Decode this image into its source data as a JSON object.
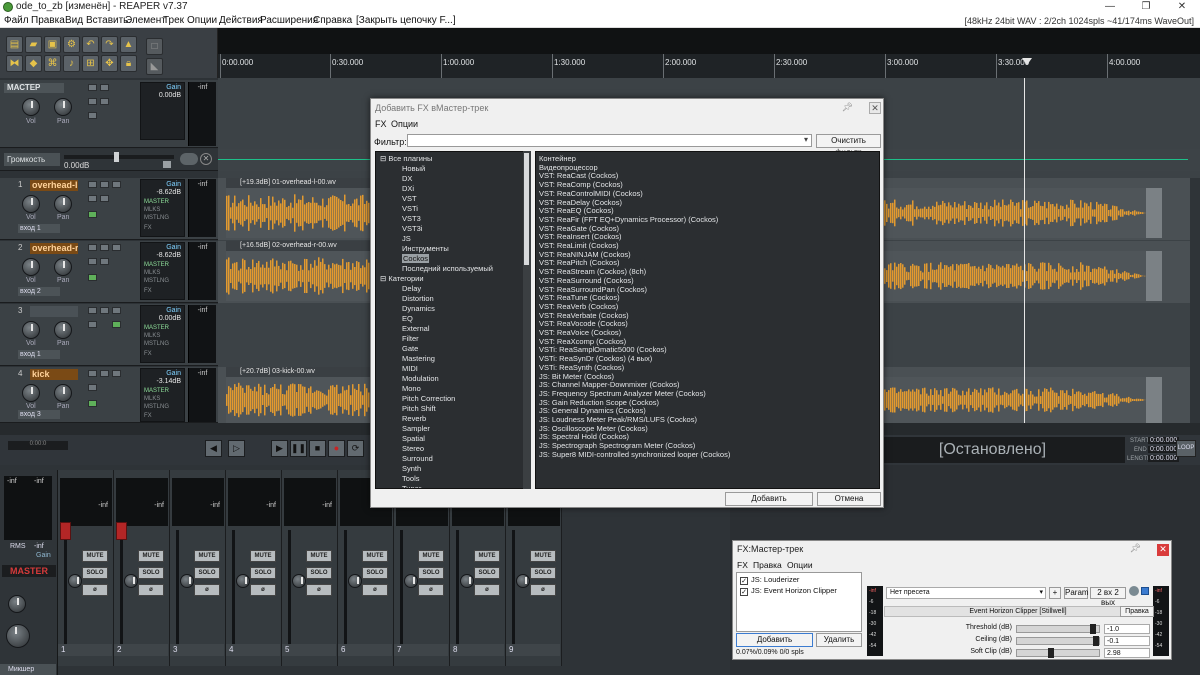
{
  "window": {
    "title": "ode_to_zb [изменён] - REAPER v7.37",
    "status_info": "[48kHz 24bit WAV : 2/2ch 1024spls ~41/174ms WaveOut]"
  },
  "menu": [
    "Файл",
    "Правка",
    "Вид",
    "Вставить",
    "Элемент",
    "Трек",
    "Опции",
    "Действия",
    "Расширения",
    "Справка",
    "[Закрыть цепочку F...]"
  ],
  "ruler": {
    "ticks": [
      "0:00.000",
      "0:30.000",
      "1:00.000",
      "1:30.000",
      "2:00.000",
      "2:30.000",
      "3:00.000",
      "3:30.000",
      "4:00.000"
    ]
  },
  "master": {
    "name": "МАСТЕР",
    "gain_label": "Gain",
    "gain_value": "0.00dB",
    "meter": "-inf",
    "vol_label": "Vol",
    "pan_label": "Pan",
    "volume_label": "Громкость",
    "volume_value": "0.00dB"
  },
  "tracks": [
    {
      "num": "1",
      "name": "overhead-l",
      "gain": "-8.62dB",
      "input": "вход 1",
      "meter": "-inf",
      "item": "[+19.3dB] 01-overhead-l-00.wv"
    },
    {
      "num": "2",
      "name": "overhead-r",
      "gain": "-8.62dB",
      "input": "вход 2",
      "meter": "-inf",
      "item": "[+16.5dB] 02-overhead-r-00.wv"
    },
    {
      "num": "3",
      "name": "",
      "gain": "0.00dB",
      "input": "вход 1",
      "meter": "-inf",
      "item": ""
    },
    {
      "num": "4",
      "name": "kick",
      "gain": "-3.14dB",
      "input": "вход 3",
      "meter": "-inf",
      "item": "[+20.7dB] 03-kick-00.wv"
    }
  ],
  "routing_labels": [
    "MASTER",
    "MLKS",
    "MSTLNG",
    "FX"
  ],
  "transport": {
    "status": "[Остановлено]",
    "start_label": "START",
    "end_label": "END",
    "length_label": "LENGTH",
    "start": "0:00.000",
    "end": "0:00.000",
    "length": "0:00.000",
    "loop_label": "LOOP",
    "counter": "0:00:0"
  },
  "mixer": {
    "master_label": "MASTER",
    "rms_label": "RMS",
    "rms_value": "-inf",
    "gain_label": "Gain",
    "tab_label": "Микшер",
    "strip_meter": "-inf",
    "mute": "MUTE",
    "solo": "SOLO",
    "strips": [
      "1",
      "2",
      "3",
      "4",
      "5",
      "6",
      "7",
      "8",
      "9"
    ]
  },
  "fx_dialog": {
    "title": "Добавить FX вМастер-трек",
    "menu": [
      "FX",
      "Опции"
    ],
    "filter_label": "Фильтр:",
    "filter_value": "",
    "clear_filter": "Очистить фильтр",
    "add": "Добавить",
    "cancel": "Отмена",
    "tree": [
      {
        "label": "Все плагины",
        "indent": 0,
        "toggle": "⊟"
      },
      {
        "label": "Новый",
        "indent": 1
      },
      {
        "label": "DX",
        "indent": 1
      },
      {
        "label": "DXi",
        "indent": 1
      },
      {
        "label": "VST",
        "indent": 1
      },
      {
        "label": "VSTi",
        "indent": 1
      },
      {
        "label": "VST3",
        "indent": 1
      },
      {
        "label": "VST3i",
        "indent": 1
      },
      {
        "label": "JS",
        "indent": 1
      },
      {
        "label": "Инструменты",
        "indent": 1
      },
      {
        "label": "Cockos",
        "indent": 1,
        "selected": true
      },
      {
        "label": "Последний используемый",
        "indent": 1
      },
      {
        "label": "Категории",
        "indent": 0,
        "toggle": "⊟"
      },
      {
        "label": "Delay",
        "indent": 1
      },
      {
        "label": "Distortion",
        "indent": 1
      },
      {
        "label": "Dynamics",
        "indent": 1
      },
      {
        "label": "EQ",
        "indent": 1
      },
      {
        "label": "External",
        "indent": 1
      },
      {
        "label": "Filter",
        "indent": 1
      },
      {
        "label": "Gate",
        "indent": 1
      },
      {
        "label": "Mastering",
        "indent": 1
      },
      {
        "label": "MIDI",
        "indent": 1
      },
      {
        "label": "Modulation",
        "indent": 1
      },
      {
        "label": "Mono",
        "indent": 1
      },
      {
        "label": "Pitch Correction",
        "indent": 1
      },
      {
        "label": "Pitch Shift",
        "indent": 1
      },
      {
        "label": "Reverb",
        "indent": 1
      },
      {
        "label": "Sampler",
        "indent": 1
      },
      {
        "label": "Spatial",
        "indent": 1
      },
      {
        "label": "Stereo",
        "indent": 1
      },
      {
        "label": "Surround",
        "indent": 1
      },
      {
        "label": "Synth",
        "indent": 1
      },
      {
        "label": "Tools",
        "indent": 1
      },
      {
        "label": "Tuner",
        "indent": 1
      }
    ],
    "plugins": [
      "Контейнер",
      "Видеопроцессор",
      "VST: ReaCast (Cockos)",
      "VST: ReaComp (Cockos)",
      "VST: ReaControlMIDI (Cockos)",
      "VST: ReaDelay (Cockos)",
      "VST: ReaEQ (Cockos)",
      "VST: ReaFir (FFT EQ+Dynamics Processor) (Cockos)",
      "VST: ReaGate (Cockos)",
      "VST: ReaInsert (Cockos)",
      "VST: ReaLimit (Cockos)",
      "VST: ReaNINJAM (Cockos)",
      "VST: ReaPitch (Cockos)",
      "VST: ReaStream (Cockos) (8ch)",
      "VST: ReaSurround (Cockos)",
      "VST: ReaSurroundPan (Cockos)",
      "VST: ReaTune (Cockos)",
      "VST: ReaVerb (Cockos)",
      "VST: ReaVerbate (Cockos)",
      "VST: ReaVocode (Cockos)",
      "VST: ReaVoice (Cockos)",
      "VST: ReaXcomp (Cockos)",
      "VSTi: ReaSamplOmatic5000 (Cockos)",
      "VSTi: ReaSynDr (Cockos) (4 вых)",
      "VSTi: ReaSynth (Cockos)",
      "JS: Bit Meter (Cockos)",
      "JS: Channel Mapper-Downmixer (Cockos)",
      "JS: Frequency Spectrum Analyzer Meter (Cockos)",
      "JS: Gain Reduction Scope (Cockos)",
      "JS: General Dynamics (Cockos)",
      "JS: Loudness Meter Peak/RMS/LUFS (Cockos)",
      "JS: Oscilloscope Meter (Cockos)",
      "JS: Spectral Hold (Cockos)",
      "JS: Spectrograph Spectrogram Meter (Cockos)",
      "JS: Super8 MIDI-controlled synchronized looper (Cockos)"
    ]
  },
  "fx_chain": {
    "title": "FX:Мастер-трек",
    "menu": [
      "FX",
      "Правка",
      "Опции"
    ],
    "items": [
      {
        "label": "JS: Louderizer",
        "checked": true
      },
      {
        "label": "JS: Event Horizon Clipper",
        "checked": true
      }
    ],
    "add": "Добавить",
    "remove": "Удалить",
    "cpu": "0.07%/0.09% 0/0 spls",
    "preset": "Нет пресета",
    "plus": "+",
    "param": "Param",
    "io": "2 вх 2 вых",
    "plugin_title": "Event Horizon Clipper [Stillwell]",
    "edit": "Правка",
    "meter_labels": [
      "-inf",
      "-6",
      "-18",
      "-30",
      "-42",
      "-54"
    ],
    "params": [
      {
        "label": "Threshold (dB)",
        "value": "-1.0",
        "pos": 0.94
      },
      {
        "label": "Ceiling (dB)",
        "value": "-0.1",
        "pos": 0.98
      },
      {
        "label": "Soft Clip (dB)",
        "value": "2.98",
        "pos": 0.4
      }
    ]
  }
}
